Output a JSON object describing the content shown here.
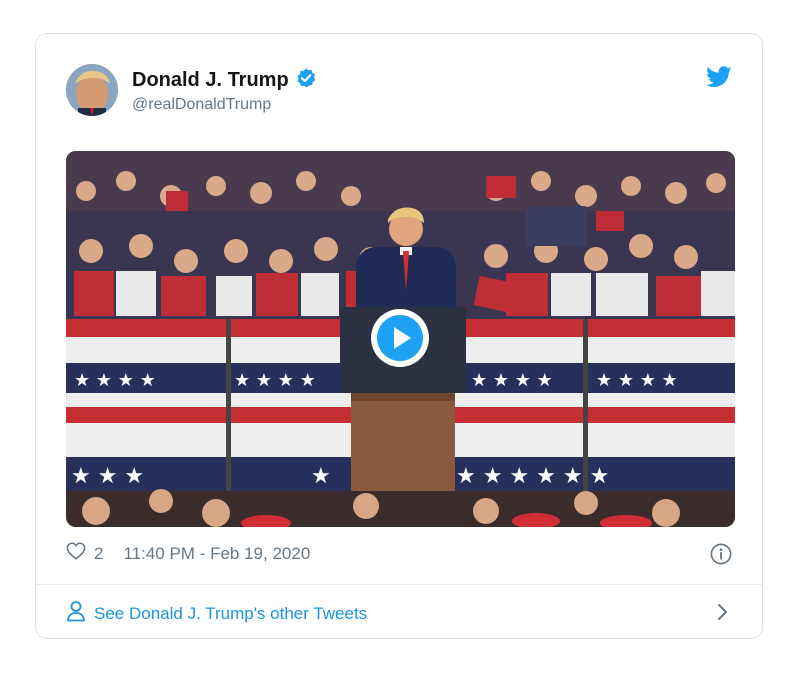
{
  "tweet": {
    "author": {
      "name": "Donald J. Trump",
      "handle": "@realDonaldTrump",
      "verified": true,
      "avatar": "avatar-photo"
    },
    "media": {
      "type": "video",
      "thumbnail": "rally-stage-podium-crowd",
      "play_icon": "play-icon"
    },
    "likes": "2",
    "timestamp": "11:40 PM - Feb 19, 2020",
    "footer_link": "See Donald J. Trump's other Tweets",
    "colors": {
      "accent": "#1da1f2",
      "link": "#1b95e0",
      "text": "#14171a",
      "muted": "#657786",
      "border": "#dfe3e8"
    },
    "icons": {
      "brand": "twitter-bird-icon",
      "verified": "verified-badge-icon",
      "like": "heart-icon",
      "info": "info-icon",
      "user": "person-icon",
      "chevron": "chevron-right-icon"
    }
  }
}
